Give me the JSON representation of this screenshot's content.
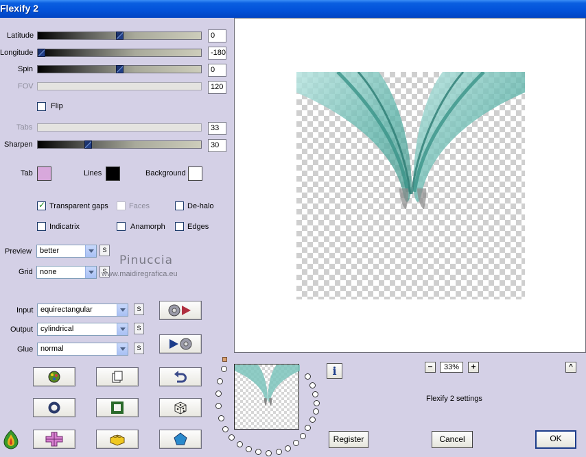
{
  "window": {
    "title": "Flexify 2"
  },
  "sliders": [
    {
      "label": "Latitude",
      "value": "0",
      "position": 0.5,
      "enabled": true
    },
    {
      "label": "Longitude",
      "value": "-180",
      "position": 0.0,
      "enabled": true
    },
    {
      "label": "Spin",
      "value": "0",
      "position": 0.5,
      "enabled": true
    },
    {
      "label": "FOV",
      "value": "120",
      "enabled": false
    },
    {
      "label": "Tabs",
      "value": "33",
      "enabled": false
    },
    {
      "label": "Sharpen",
      "value": "30",
      "position": 0.3,
      "enabled": true
    }
  ],
  "flip": {
    "label": "Flip",
    "checked": false
  },
  "colors": {
    "tab_label": "Tab",
    "tab": "#d8a8dc",
    "lines_label": "Lines",
    "lines": "#000000",
    "background_label": "Background",
    "background": "#ffffff"
  },
  "options": {
    "transparent_gaps": {
      "label": "Transparent gaps",
      "checked": true
    },
    "faces": {
      "label": "Faces",
      "checked": false,
      "enabled": false
    },
    "de_halo": {
      "label": "De-halo",
      "checked": false
    },
    "indicatrix": {
      "label": "Indicatrix",
      "checked": false
    },
    "anamorph": {
      "label": "Anamorph",
      "checked": false
    },
    "edges": {
      "label": "Edges",
      "checked": false
    }
  },
  "preview_select": {
    "label": "Preview",
    "value": "better"
  },
  "grid_select": {
    "label": "Grid",
    "value": "none"
  },
  "watermark": {
    "name": "Pinuccia",
    "site": "www.maidiregrafica.eu"
  },
  "input_select": {
    "label": "Input",
    "value": "equirectangular"
  },
  "output_select": {
    "label": "Output",
    "value": "cylindrical"
  },
  "glue_select": {
    "label": "Glue",
    "value": "normal"
  },
  "s_button": "S",
  "zoom": {
    "value": "33%",
    "minus": "−",
    "plus": "+"
  },
  "status": "Flexify 2 settings",
  "info_button": "i",
  "collapse_button": "^",
  "buttons": {
    "register": "Register",
    "cancel": "Cancel",
    "ok": "OK"
  },
  "icons": {
    "swap_in": "disc-arrow-icon",
    "swap_out": "arrow-disc-icon",
    "randomize_color": "palette-icon",
    "copy": "copy-pages-icon",
    "undo": "undo-arrow-icon",
    "ring": "ring-icon",
    "frame": "square-frame-icon",
    "dice": "dice-icon",
    "cross": "pink-cross-icon",
    "block": "yellow-block-icon",
    "pentagon": "pentagon-icon",
    "logo": "flaming-pear-icon"
  }
}
